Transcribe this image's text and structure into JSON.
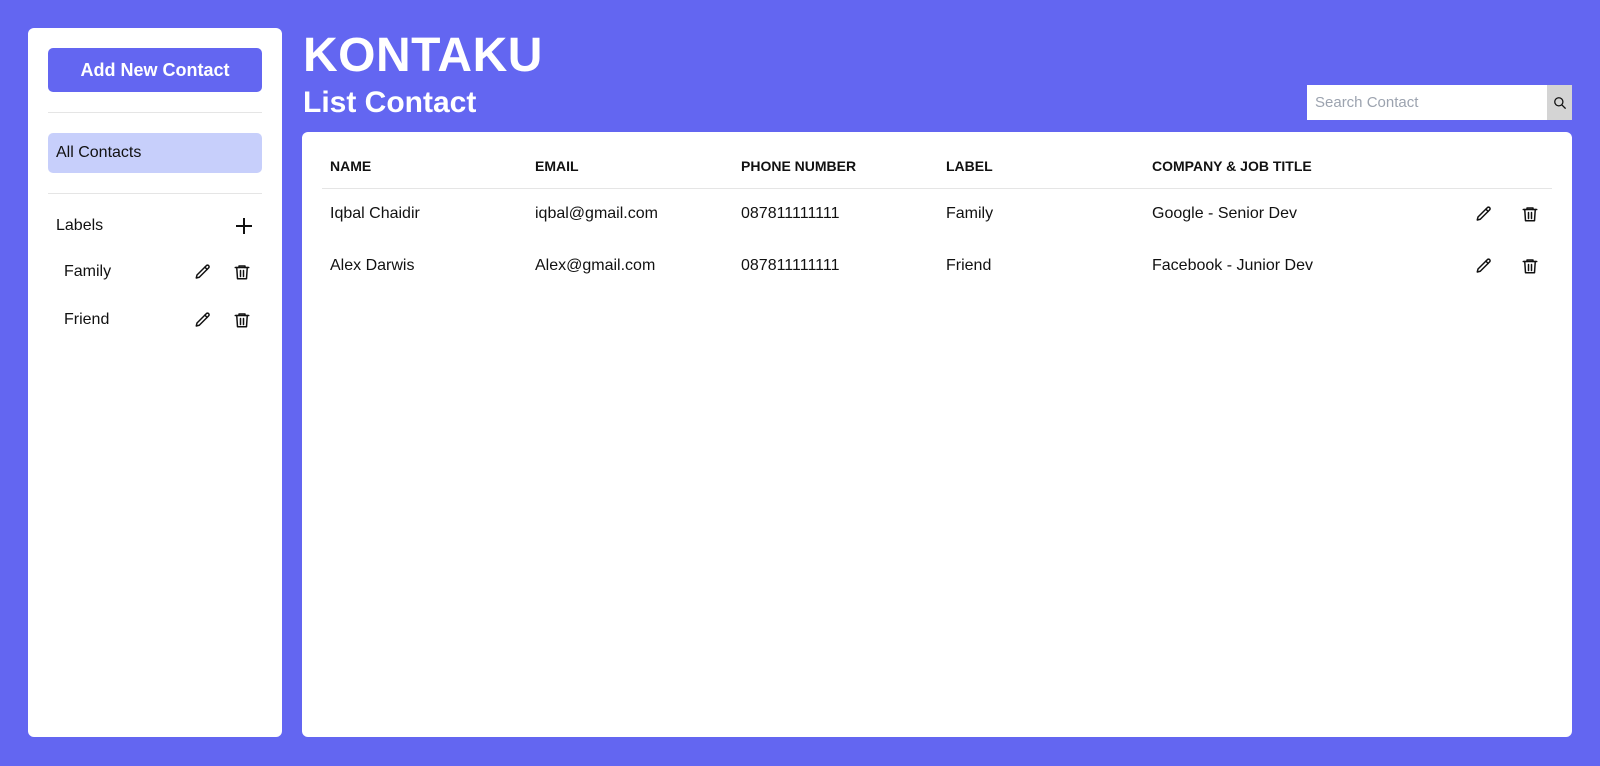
{
  "sidebar": {
    "add_button_label": "Add New Contact",
    "all_contacts_label": "All Contacts",
    "labels_heading": "Labels",
    "labels": [
      {
        "name": "Family"
      },
      {
        "name": "Friend"
      }
    ]
  },
  "header": {
    "app_title": "KONTAKU",
    "page_title": "List Contact",
    "search_placeholder": "Search Contact"
  },
  "table": {
    "columns": [
      "NAME",
      "EMAIL",
      "PHONE NUMBER",
      "LABEL",
      "COMPANY & JOB TITLE"
    ],
    "rows": [
      {
        "name": "Iqbal Chaidir",
        "email": "iqbal@gmail.com",
        "phone": "087811111111",
        "label": "Family",
        "company": "Google - Senior Dev"
      },
      {
        "name": "Alex Darwis",
        "email": "Alex@gmail.com",
        "phone": "087811111111",
        "label": "Friend",
        "company": "Facebook - Junior Dev"
      }
    ]
  },
  "colors": {
    "background": "#6366f1",
    "accent": "#6366f1",
    "active_nav": "#c7cffb"
  }
}
